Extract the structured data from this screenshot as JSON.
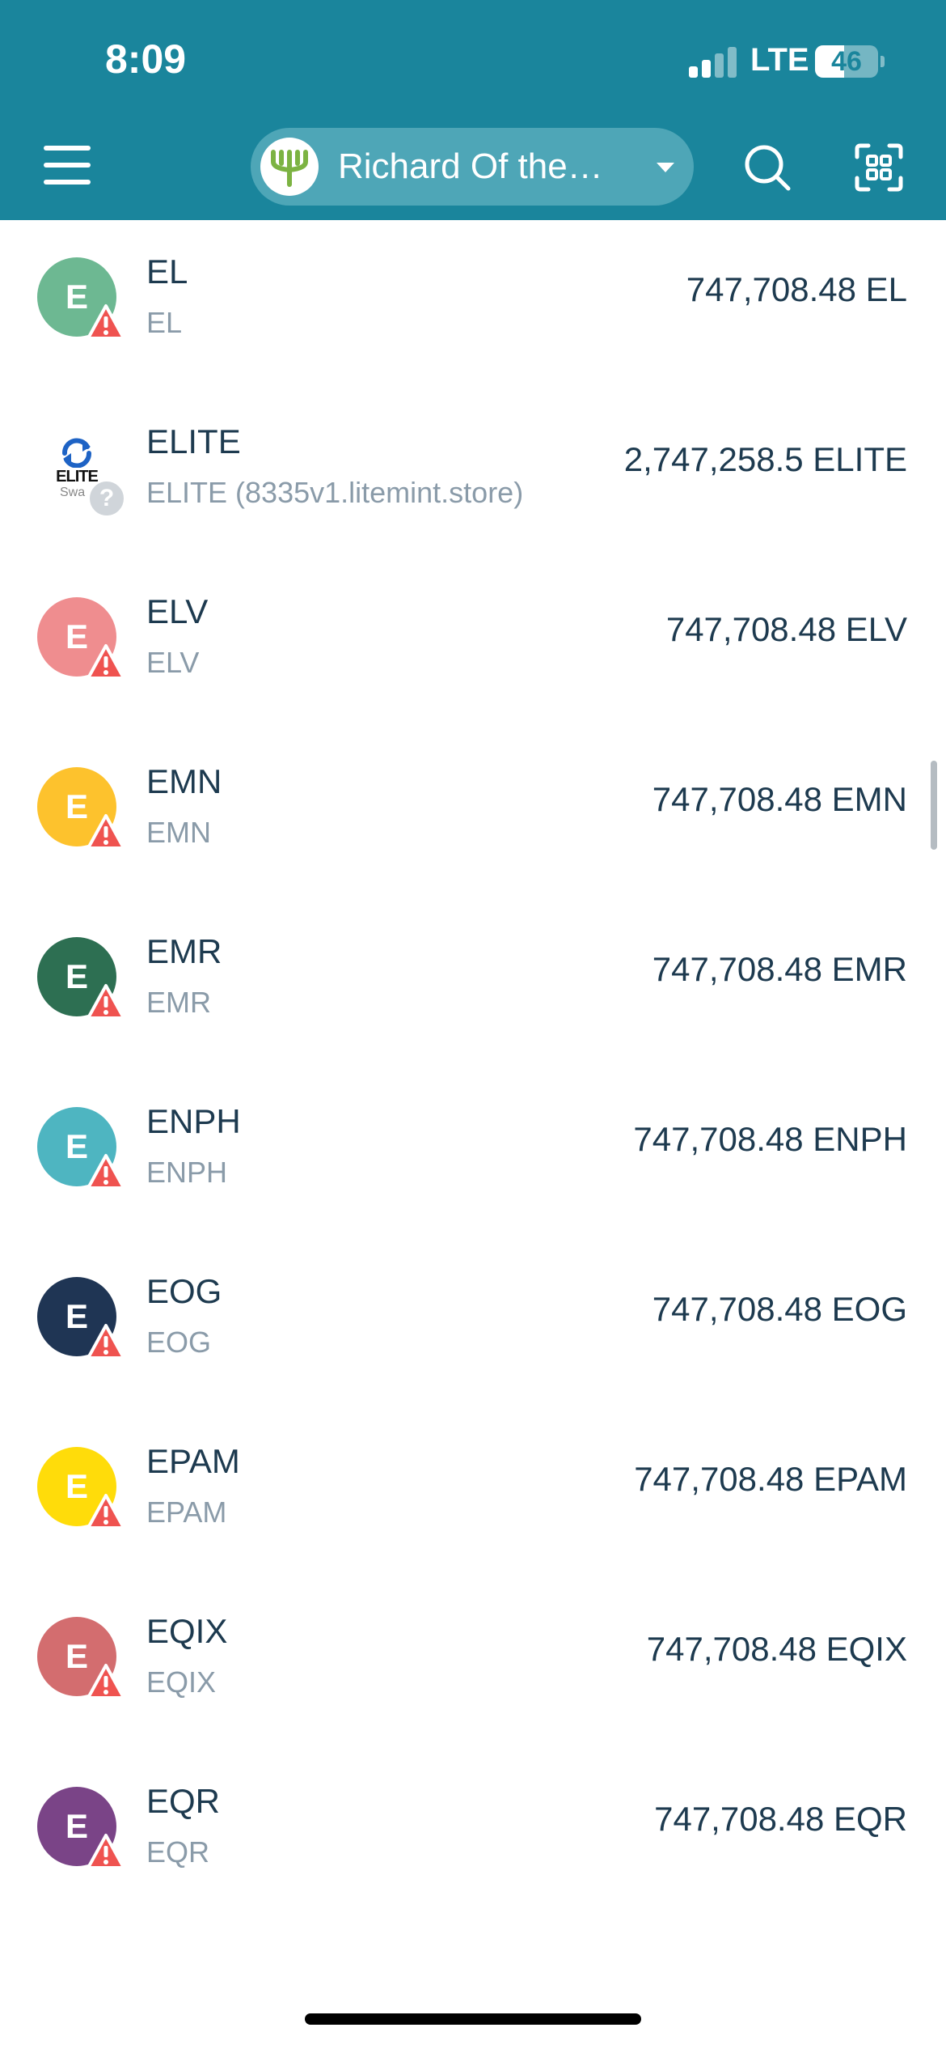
{
  "status_bar": {
    "time": "8:09",
    "network": "LTE",
    "battery": "46",
    "battery_level": 0.46
  },
  "header": {
    "account_name": "Richard Of the…",
    "icons": {
      "menu": "hamburger-menu-icon",
      "account": "tree-avatar-icon",
      "caret": "chevron-down-icon",
      "search": "search-icon",
      "scan": "qr-scan-icon"
    }
  },
  "colors": {
    "header_bg": "#1a859c",
    "pill_bg": "#4ea6b7",
    "symbol_text": "#1d3a4f",
    "subname_text": "#8a9ba9",
    "warning": "#ef5350",
    "account_avatar": "#7cb342"
  },
  "tokens": [
    {
      "letter": "E",
      "symbol": "EL",
      "name": "EL",
      "balance": "747,708.48 EL",
      "color": "#6db892",
      "badge": "warning"
    },
    {
      "letter": "",
      "symbol": "ELITE",
      "name": "ELITE (8335v1.litemint.store)",
      "balance": "2,747,258.5 ELITE",
      "color": "#ffffff",
      "badge": "unknown",
      "logo_text": "ELITE",
      "logo_sub": "Swa"
    },
    {
      "letter": "E",
      "symbol": "ELV",
      "name": "ELV",
      "balance": "747,708.48 ELV",
      "color": "#ef8d8f",
      "badge": "warning"
    },
    {
      "letter": "E",
      "symbol": "EMN",
      "name": "EMN",
      "balance": "747,708.48 EMN",
      "color": "#fdc22d",
      "badge": "warning"
    },
    {
      "letter": "E",
      "symbol": "EMR",
      "name": "EMR",
      "balance": "747,708.48 EMR",
      "color": "#2d6f52",
      "badge": "warning"
    },
    {
      "letter": "E",
      "symbol": "ENPH",
      "name": "ENPH",
      "balance": "747,708.48 ENPH",
      "color": "#4eb5c1",
      "badge": "warning"
    },
    {
      "letter": "E",
      "symbol": "EOG",
      "name": "EOG",
      "balance": "747,708.48 EOG",
      "color": "#1f3554",
      "badge": "warning"
    },
    {
      "letter": "E",
      "symbol": "EPAM",
      "name": "EPAM",
      "balance": "747,708.48 EPAM",
      "color": "#ffdc0a",
      "badge": "warning"
    },
    {
      "letter": "E",
      "symbol": "EQIX",
      "name": "EQIX",
      "balance": "747,708.48 EQIX",
      "color": "#d36d6f",
      "badge": "warning"
    },
    {
      "letter": "E",
      "symbol": "EQR",
      "name": "EQR",
      "balance": "747,708.48 EQR",
      "color": "#7a4487",
      "badge": "warning"
    }
  ]
}
